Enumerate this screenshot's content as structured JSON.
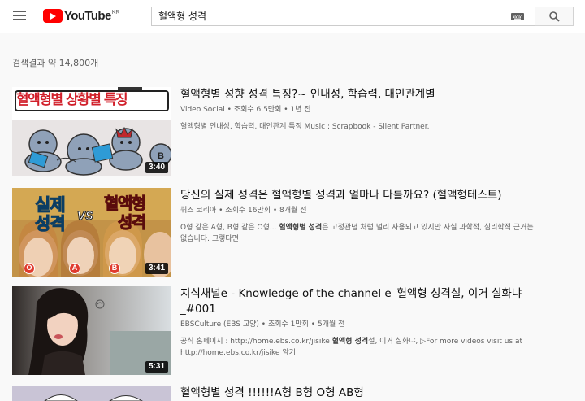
{
  "header": {
    "logo_text": "YouTube",
    "logo_region": "KR",
    "search_value": "혈액형 성격"
  },
  "results": {
    "count": "검색결과 약 14,800개",
    "items": [
      {
        "title": "혈액형별 성향 성격 특징?~ 인내성, 학습력, 대인관계별",
        "channel": "Video Social",
        "views": "조회수 6.5만회",
        "age": "1년 전",
        "description": "혈액형별 인내성, 학습력, 대인관계 특징 Music : Scrapbook - Silent Partner.",
        "duration": "3:40",
        "thumb_text": "혈액형별 상황별 특징"
      },
      {
        "title": "당신의 실제 성격은 혈액형별 성격과 얼마나 다를까요? (혈액형테스트)",
        "channel": "퀴즈 코리아",
        "views": "조회수 16만회",
        "age": "8개월 전",
        "description_parts": [
          "O형 같은 A형, B형 같은 O형... ",
          "혈액형별 성격",
          "은 고정관념 처럼 널리 사용되고 있지만 사실 과학적, 심리학적 근거는 없습니다. 그렇다면"
        ],
        "duration": "3:41",
        "thumb_text_1": "실제",
        "thumb_text_2": "성격",
        "thumb_text_vs": "vs",
        "thumb_text_3": "혈액형",
        "thumb_text_4": "성격",
        "badges": [
          "O",
          "A",
          "B"
        ]
      },
      {
        "title": "지식채널e - Knowledge of the channel e_혈액형 성격설, 이거 실화냐_#001",
        "channel": "EBSCulture (EBS 교양)",
        "views": "조회수 1만회",
        "age": "5개월 전",
        "description_parts": [
          "공식 홈페이지 : http://home.ebs.co.kr/jisike ",
          "혈액형 성격",
          "설, 이거 실화냐, ▷For more videos visit us at http://home.ebs.co.kr/jisike 암기"
        ],
        "duration": "5:31"
      },
      {
        "title": "혈액형별 성격 !!!!!!A형 B형 O형 AB형"
      }
    ]
  },
  "colors": {
    "brand_red": "#ff0000",
    "meta_gray": "#606060"
  },
  "icons": [
    "menu-icon",
    "youtube-logo-icon",
    "keyboard-icon",
    "search-icon"
  ]
}
